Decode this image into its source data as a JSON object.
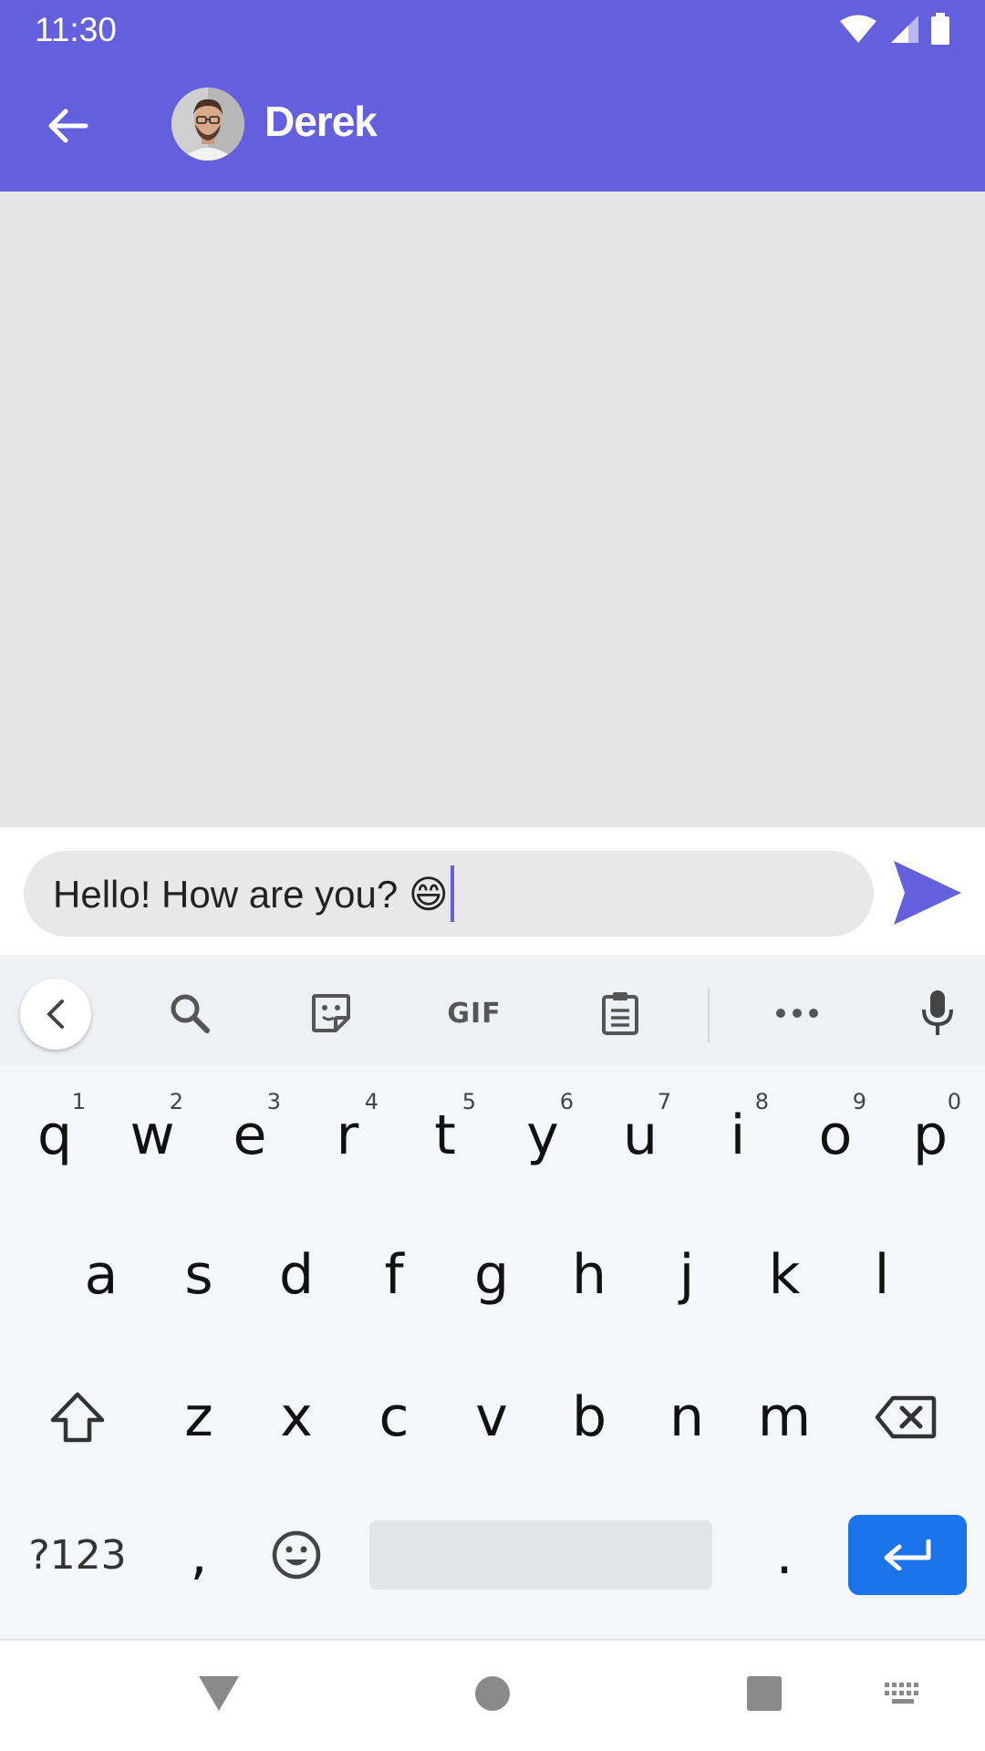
{
  "status_bar": {
    "time": "11:30"
  },
  "header": {
    "contact_name": "Derek",
    "back_icon": "arrow-back-icon",
    "bg_color": "#635fdd"
  },
  "composer": {
    "message_text": "Hello! How are you? 😄",
    "send_icon": "send-icon",
    "accent_color": "#635fdd"
  },
  "keyboard": {
    "toolbar": {
      "gif_label": "GIF"
    },
    "row1": [
      {
        "key": "q",
        "hint": "1"
      },
      {
        "key": "w",
        "hint": "2"
      },
      {
        "key": "e",
        "hint": "3"
      },
      {
        "key": "r",
        "hint": "4"
      },
      {
        "key": "t",
        "hint": "5"
      },
      {
        "key": "y",
        "hint": "6"
      },
      {
        "key": "u",
        "hint": "7"
      },
      {
        "key": "i",
        "hint": "8"
      },
      {
        "key": "o",
        "hint": "9"
      },
      {
        "key": "p",
        "hint": "0"
      }
    ],
    "row2": [
      "a",
      "s",
      "d",
      "f",
      "g",
      "h",
      "j",
      "k",
      "l"
    ],
    "row3": [
      "z",
      "x",
      "c",
      "v",
      "b",
      "n",
      "m"
    ],
    "symbols_label": "?123",
    "comma": ",",
    "period": ".",
    "enter_color": "#1a73e8"
  }
}
